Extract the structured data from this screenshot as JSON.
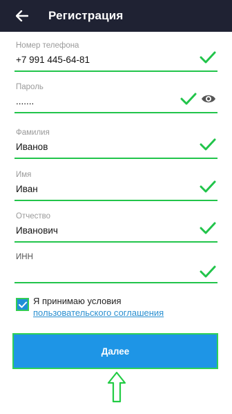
{
  "header": {
    "title": "Регистрация"
  },
  "icons": {
    "back": "arrow-left-icon",
    "valid": "checkmark-icon",
    "toggle_password": "eye-icon",
    "hint": "arrow-up-icon"
  },
  "colors": {
    "appbar": "#1f2233",
    "valid_green": "#21c44a",
    "primary_blue": "#1e95e6",
    "link_blue": "#2a8fd0"
  },
  "form": {
    "phone": {
      "label": "Номер телефона",
      "value": "+7 991 445-64-81"
    },
    "password": {
      "label": "Пароль",
      "value": "......."
    },
    "surname": {
      "label": "Фамилия",
      "value": "Иванов"
    },
    "name": {
      "label": "Имя",
      "value": "Иван"
    },
    "patronymic": {
      "label": "Отчество",
      "value": "Иванович"
    },
    "inn": {
      "label": "ИНН",
      "value": ""
    }
  },
  "agreement": {
    "checked": true,
    "text": "Я принимаю условия",
    "link": "пользовательского соглашения"
  },
  "actions": {
    "next_label": "Далее"
  }
}
